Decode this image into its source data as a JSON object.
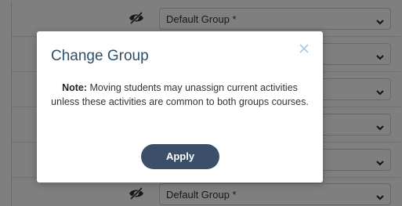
{
  "background_table": {
    "rows": [
      {
        "select_value": "Default Group *",
        "visibility": "hidden"
      },
      {
        "select_value": "",
        "visibility": "hidden"
      },
      {
        "select_value": "",
        "visibility": "hidden"
      },
      {
        "select_value": "",
        "visibility": "hidden"
      },
      {
        "select_value": "",
        "visibility": "hidden"
      },
      {
        "select_value": "Default Group *",
        "visibility": "hidden"
      }
    ]
  },
  "modal": {
    "title": "Change Group",
    "close_icon": "close-icon",
    "note_label": "Note:",
    "note_text": " Moving students may unassign current activities unless these activities are common to both groups courses.",
    "apply_label": "Apply"
  },
  "colors": {
    "primary_button": "#3b5068",
    "title": "#2f4f69",
    "close_icon": "#a9c7dd"
  }
}
